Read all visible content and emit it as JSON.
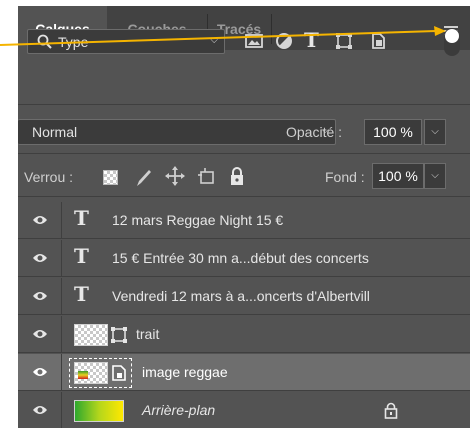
{
  "tabs": [
    {
      "label": "Calques",
      "active": true
    },
    {
      "label": "Couches",
      "active": false
    },
    {
      "label": "Tracés",
      "active": false
    }
  ],
  "filter": {
    "type_label": "Type",
    "icons": [
      "image-filter-icon",
      "adjustment-filter-icon",
      "text-filter-icon",
      "shape-filter-icon",
      "smart-object-filter-icon"
    ]
  },
  "blend": {
    "mode": "Normal",
    "opacity_label": "Opacité :",
    "opacity_value": "100 %"
  },
  "lock": {
    "label": "Verrou :",
    "fill_label": "Fond :",
    "fill_value": "100 %"
  },
  "layers": [
    {
      "name": "12 mars  Reggae Night  15 €",
      "kind": "text"
    },
    {
      "name": "15 € Entrée 30 mn a...début des concerts",
      "kind": "text"
    },
    {
      "name": "Vendredi 12 mars à a...oncerts d'Albertvill",
      "kind": "text"
    },
    {
      "name": "trait",
      "kind": "shape"
    },
    {
      "name": "image reggae",
      "kind": "smart-object",
      "selected": true
    },
    {
      "name": "Arrière-plan",
      "kind": "background",
      "locked": true
    }
  ],
  "colors": {
    "panel": "#535353",
    "tabbar": "#424242",
    "annotation_arrow": "#f5b400",
    "selected_row": "#6e6e6e"
  }
}
